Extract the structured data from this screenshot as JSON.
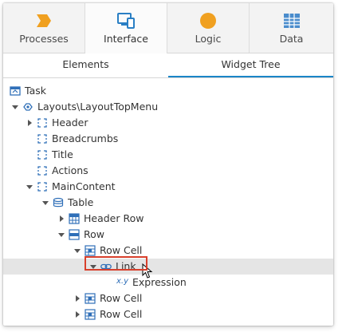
{
  "category_tabs": [
    {
      "label": "Processes",
      "icon": "processes-icon",
      "color": "#f0a020"
    },
    {
      "label": "Interface",
      "icon": "interface-icon",
      "color": "#2a7fc4"
    },
    {
      "label": "Logic",
      "icon": "logic-icon",
      "color": "#f0a020"
    },
    {
      "label": "Data",
      "icon": "data-icon",
      "color": "#4a8ccc"
    }
  ],
  "active_category": "Interface",
  "sub_tabs": [
    {
      "label": "Elements"
    },
    {
      "label": "Widget Tree"
    }
  ],
  "active_sub_tab": "Widget Tree",
  "tree": [
    {
      "label": "Task",
      "icon": "task-icon",
      "expander": "none",
      "depth": 0
    },
    {
      "label": "Layouts\\LayoutTopMenu",
      "icon": "layout-block-icon",
      "expander": "expanded",
      "depth": 0
    },
    {
      "label": "Header",
      "icon": "placeholder-icon",
      "expander": "collapsed",
      "depth": 1
    },
    {
      "label": "Breadcrumbs",
      "icon": "placeholder-icon",
      "expander": "none",
      "depth": 1
    },
    {
      "label": "Title",
      "icon": "placeholder-icon",
      "expander": "none",
      "depth": 1
    },
    {
      "label": "Actions",
      "icon": "placeholder-icon",
      "expander": "none",
      "depth": 1
    },
    {
      "label": "MainContent",
      "icon": "placeholder-icon",
      "expander": "expanded",
      "depth": 1
    },
    {
      "label": "Table",
      "icon": "table-icon",
      "expander": "expanded",
      "depth": 2
    },
    {
      "label": "Header Row",
      "icon": "header-row-icon",
      "expander": "collapsed",
      "depth": 3
    },
    {
      "label": "Row",
      "icon": "row-icon",
      "expander": "expanded",
      "depth": 3
    },
    {
      "label": "Row Cell",
      "icon": "row-cell-icon",
      "expander": "expanded",
      "depth": 4
    },
    {
      "label": "Link",
      "icon": "link-icon",
      "expander": "expanded",
      "depth": 5,
      "selected": true
    },
    {
      "label": "Expression",
      "icon": "expression-icon",
      "expander": "none",
      "depth": 6
    },
    {
      "label": "Row Cell",
      "icon": "row-cell-icon",
      "expander": "collapsed",
      "depth": 4
    },
    {
      "label": "Row Cell",
      "icon": "row-cell-icon",
      "expander": "collapsed",
      "depth": 4
    }
  ],
  "icon_glyphs": {
    "expression": "x.y"
  },
  "colors": {
    "accent": "#1a86c8",
    "highlight_border": "#d8402c",
    "selected_row": "#e5e5e5",
    "icon_blue": "#2f6fb8"
  }
}
